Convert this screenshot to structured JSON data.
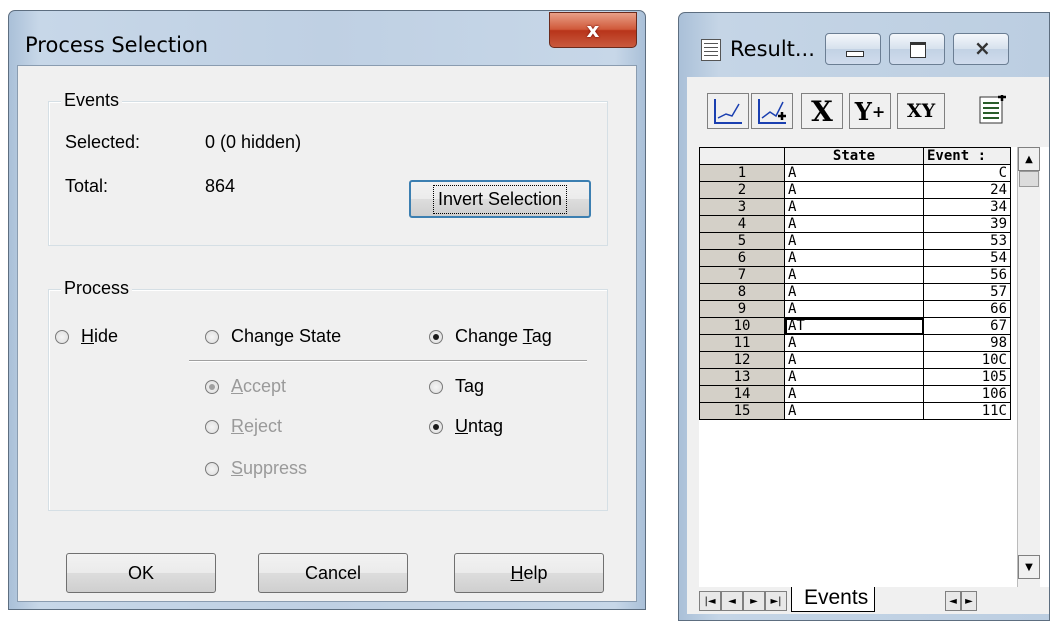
{
  "dialog": {
    "title": "Process Selection",
    "close_glyph": "x",
    "events_group": {
      "label": "Events",
      "selected_label": "Selected:",
      "selected_value": "0  (0 hidden)",
      "total_label": "Total:",
      "total_value": "864",
      "invert_button": "Invert Selection"
    },
    "process_group": {
      "label": "Process",
      "options": [
        {
          "label": "Hide",
          "accel": "H",
          "rest": "ide",
          "checked": false
        },
        {
          "label": "Change State",
          "checked": false
        },
        {
          "label": "Change Tag",
          "pre": "Change ",
          "accel": "T",
          "rest": "ag",
          "checked": true
        }
      ],
      "state_options": [
        {
          "label": "Accept",
          "accel": "A",
          "rest": "ccept",
          "checked": true,
          "disabled": true
        },
        {
          "label": "Reject",
          "accel": "R",
          "rest": "eject",
          "checked": false,
          "disabled": true
        },
        {
          "label": "Suppress",
          "accel": "S",
          "rest": "uppress",
          "checked": false,
          "disabled": true
        }
      ],
      "tag_options": [
        {
          "label": "Tag",
          "checked": false
        },
        {
          "label": "Untag",
          "accel": "U",
          "rest": "ntag",
          "checked": true
        }
      ]
    },
    "buttons": {
      "ok": "OK",
      "cancel": "Cancel",
      "help_accel": "H",
      "help_rest": "elp"
    }
  },
  "result_window": {
    "title": "Result...",
    "toolbar": {
      "x_label": "X",
      "y_label": "Y",
      "y_plus": "+",
      "xy_label": "XY"
    },
    "columns": [
      "",
      "State",
      "Event :"
    ],
    "rows": [
      {
        "n": "1",
        "state": "A",
        "event": "C"
      },
      {
        "n": "2",
        "state": "A",
        "event": "24"
      },
      {
        "n": "3",
        "state": "A",
        "event": "34"
      },
      {
        "n": "4",
        "state": "A",
        "event": "39"
      },
      {
        "n": "5",
        "state": "A",
        "event": "53"
      },
      {
        "n": "6",
        "state": "A",
        "event": "54"
      },
      {
        "n": "7",
        "state": "A",
        "event": "56"
      },
      {
        "n": "8",
        "state": "A",
        "event": "57"
      },
      {
        "n": "9",
        "state": "A",
        "event": "66"
      },
      {
        "n": "10",
        "state": "AT",
        "event": "67"
      },
      {
        "n": "11",
        "state": "A",
        "event": "98"
      },
      {
        "n": "12",
        "state": "A",
        "event": "10C"
      },
      {
        "n": "13",
        "state": "A",
        "event": "105"
      },
      {
        "n": "14",
        "state": "A",
        "event": "106"
      },
      {
        "n": "15",
        "state": "A",
        "event": "11C"
      }
    ],
    "sheet_tab": "Events",
    "nav_glyphs": [
      "|◄",
      "◄",
      "►",
      "►|"
    ]
  }
}
